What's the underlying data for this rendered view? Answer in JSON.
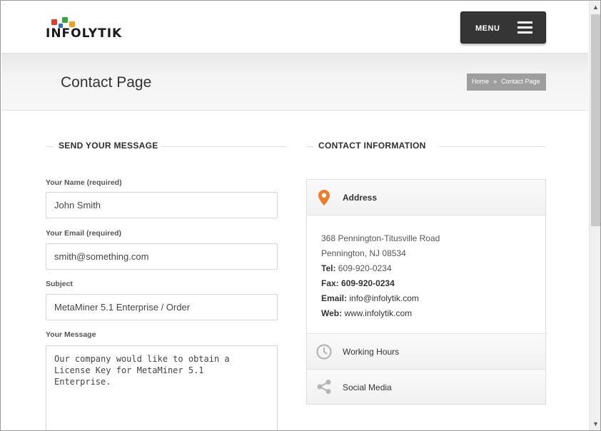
{
  "header": {
    "logo_text": "INFOLYTIK",
    "menu_label": "MENU"
  },
  "title_band": {
    "page_title": "Contact Page",
    "breadcrumb": [
      "Home",
      "Contact Page"
    ],
    "breadcrumb_sep": "»"
  },
  "form": {
    "heading": "SEND YOUR MESSAGE",
    "name_label": "Your Name (required)",
    "name_value": "John Smith",
    "email_label": "Your Email (required)",
    "email_value": "smith@something.com",
    "subject_label": "Subject",
    "subject_value": "MetaMiner 5.1 Enterprise / Order",
    "message_label": "Your Message",
    "message_value": "Our company would like to obtain a\nLicense Key for MetaMiner 5.1\nEnterprise."
  },
  "contact": {
    "heading": "CONTACT INFORMATION",
    "address_title": "Address",
    "address_line1": "368 Pennington-Titusville Road",
    "address_line2": "Pennington, NJ 08534",
    "tel_label": "Tel:",
    "tel_value": "609-920-0234",
    "fax_label": "Fax:",
    "fax_value": "609-920-0234",
    "email_label": "Email:",
    "email_value": "info@infolytik.com",
    "web_label": "Web:",
    "web_value": "www.infolytik.com",
    "working_hours": "Working Hours",
    "social_media": "Social Media"
  },
  "colors": {
    "accent": "#f07c2a",
    "menu_bg": "#353535",
    "breadcrumb_bg": "#9e9e9e",
    "icon_gray": "#b5b5b5"
  },
  "icons": {
    "address": "map-pin-icon",
    "hours": "clock-icon",
    "social": "share-icon",
    "menu": "hamburger-icon"
  }
}
